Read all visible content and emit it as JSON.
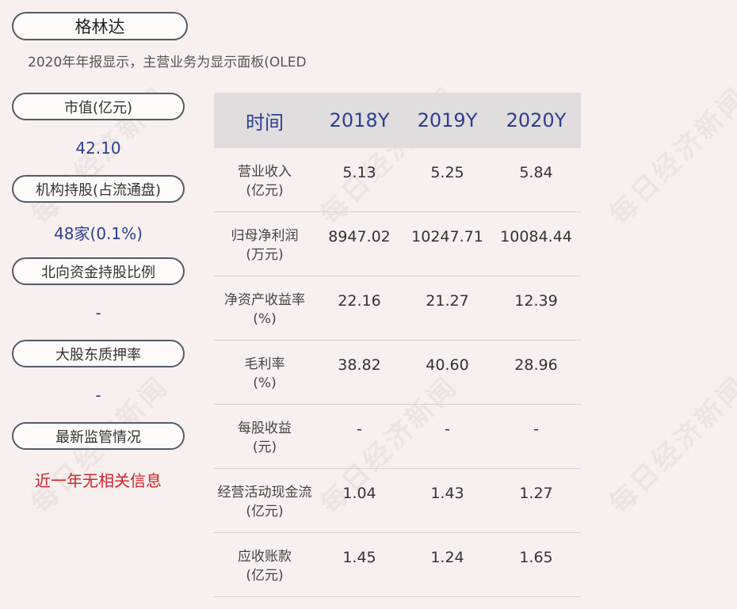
{
  "company": "格林达",
  "subtitle": "2020年年报显示，主营业务为显示面板(OLED",
  "watermark": "每日经济新闻",
  "left_panel": [
    {
      "label": "市值(亿元)",
      "value": "42.10"
    },
    {
      "label": "机构持股(占流通盘)",
      "value": "48家(0.1%)"
    },
    {
      "label": "北向资金持股比例",
      "value": "-"
    },
    {
      "label": "大股东质押率",
      "value": "-"
    },
    {
      "label": "最新监管情况",
      "value": "近一年无相关信息"
    }
  ],
  "table": {
    "headers": [
      "时间",
      "2018Y",
      "2019Y",
      "2020Y"
    ],
    "rows": [
      {
        "label1": "营业收入",
        "label2": "(亿元)",
        "values": [
          "5.13",
          "5.25",
          "5.84"
        ]
      },
      {
        "label1": "归母净利润",
        "label2": "(万元)",
        "values": [
          "8947.02",
          "10247.71",
          "10084.44"
        ]
      },
      {
        "label1": "净资产收益率",
        "label2": "(%)",
        "values": [
          "22.16",
          "21.27",
          "12.39"
        ]
      },
      {
        "label1": "毛利率",
        "label2": "(%)",
        "values": [
          "38.82",
          "40.60",
          "28.96"
        ]
      },
      {
        "label1": "每股收益",
        "label2": "(元)",
        "values": [
          "-",
          "-",
          "-"
        ]
      },
      {
        "label1": "经营活动现金流",
        "label2": "(亿元)",
        "values": [
          "1.04",
          "1.43",
          "1.27"
        ]
      },
      {
        "label1": "应收账款",
        "label2": "(亿元)",
        "values": [
          "1.45",
          "1.24",
          "1.65"
        ]
      }
    ]
  }
}
